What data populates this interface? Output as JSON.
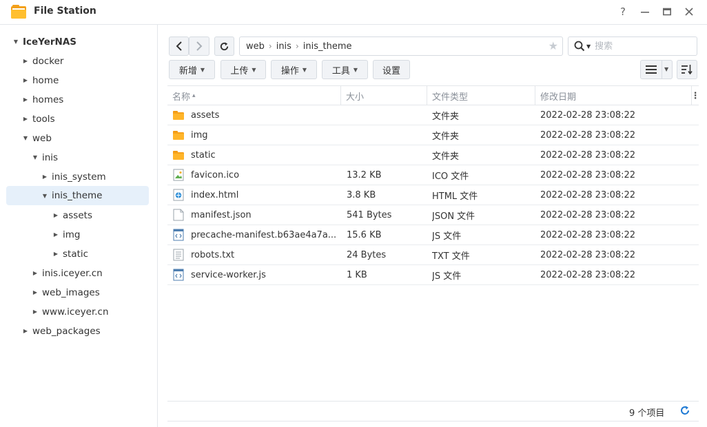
{
  "window": {
    "title": "File Station",
    "help": "?",
    "minimize": "—",
    "maximize": "▭",
    "close": "✕"
  },
  "sidebar": {
    "items": [
      {
        "label": "IceYerNAS",
        "expanded": true
      },
      {
        "label": "docker",
        "expanded": false
      },
      {
        "label": "home",
        "expanded": false
      },
      {
        "label": "homes",
        "expanded": false
      },
      {
        "label": "tools",
        "expanded": false
      },
      {
        "label": "web",
        "expanded": true
      },
      {
        "label": "inis",
        "expanded": true
      },
      {
        "label": "inis_system",
        "expanded": false
      },
      {
        "label": "inis_theme",
        "expanded": true,
        "selected": true
      },
      {
        "label": "assets",
        "expanded": false
      },
      {
        "label": "img",
        "expanded": false
      },
      {
        "label": "static",
        "expanded": false
      },
      {
        "label": "inis.iceyer.cn",
        "expanded": false
      },
      {
        "label": "web_images",
        "expanded": false
      },
      {
        "label": "www.iceyer.cn",
        "expanded": false
      },
      {
        "label": "web_packages",
        "expanded": false
      }
    ]
  },
  "toolbar": {
    "breadcrumb": [
      "web",
      "inis",
      "inis_theme"
    ],
    "search_placeholder": "搜索",
    "buttons": {
      "new": "新增",
      "upload": "上传",
      "action": "操作",
      "tools": "工具",
      "settings": "设置"
    }
  },
  "table": {
    "headers": {
      "name": "名称",
      "sort_indicator": "▴",
      "size": "大小",
      "type": "文件类型",
      "modified": "修改日期"
    },
    "rows": [
      {
        "icon": "folder-icon",
        "name": "assets",
        "size": "",
        "type": "文件夹",
        "modified": "2022-02-28 23:08:22"
      },
      {
        "icon": "folder-icon",
        "name": "img",
        "size": "",
        "type": "文件夹",
        "modified": "2022-02-28 23:08:22"
      },
      {
        "icon": "folder-icon",
        "name": "static",
        "size": "",
        "type": "文件夹",
        "modified": "2022-02-28 23:08:22"
      },
      {
        "icon": "image-file-icon",
        "name": "favicon.ico",
        "size": "13.2 KB",
        "type": "ICO 文件",
        "modified": "2022-02-28 23:08:22"
      },
      {
        "icon": "html-file-icon",
        "name": "index.html",
        "size": "3.8 KB",
        "type": "HTML 文件",
        "modified": "2022-02-28 23:08:22"
      },
      {
        "icon": "blank-file-icon",
        "name": "manifest.json",
        "size": "541 Bytes",
        "type": "JSON 文件",
        "modified": "2022-02-28 23:08:22"
      },
      {
        "icon": "code-file-icon",
        "name": "precache-manifest.b63ae4a7a...",
        "size": "15.6 KB",
        "type": "JS 文件",
        "modified": "2022-02-28 23:08:22"
      },
      {
        "icon": "text-file-icon",
        "name": "robots.txt",
        "size": "24 Bytes",
        "type": "TXT 文件",
        "modified": "2022-02-28 23:08:22"
      },
      {
        "icon": "code-file-icon",
        "name": "service-worker.js",
        "size": "1 KB",
        "type": "JS 文件",
        "modified": "2022-02-28 23:08:22"
      }
    ]
  },
  "footer": {
    "item_count": "9 个项目"
  },
  "colors": {
    "accent": "#1f7ad4",
    "folder": "#f7a21b",
    "selected_bg": "#e6f0fa"
  }
}
